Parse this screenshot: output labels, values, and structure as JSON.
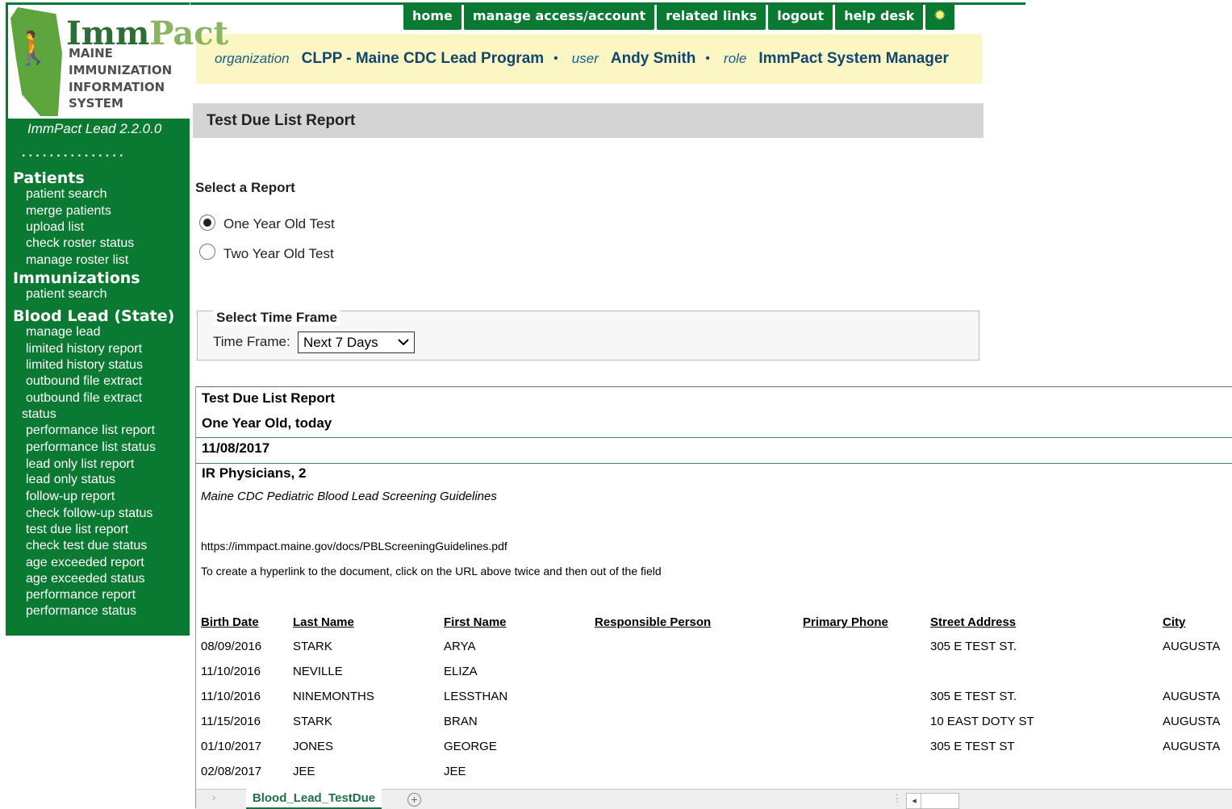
{
  "nav": {
    "home": "home",
    "manage": "manage access/account",
    "related": "related links",
    "logout": "logout",
    "help": "help desk",
    "bulb_icon": "lightbulb-icon"
  },
  "info": {
    "org_label": "organization",
    "org": "CLPP - Maine CDC Lead Program",
    "sep": "•",
    "user_label": "user",
    "user": "Andy Smith",
    "role_label": "role",
    "role": "ImmPact System Manager"
  },
  "logo": {
    "imm": "Imm",
    "pact": "Pact",
    "line1": "MAINE",
    "line2": "IMMUNIZATION",
    "line3": "INFORMATION",
    "line4": "SYSTEM"
  },
  "sidebar": {
    "version": "ImmPact Lead 2.2.0.0",
    "dots": "...............",
    "sections": {
      "patients": "Patients",
      "immunizations": "Immunizations",
      "lead": "Blood Lead (State)"
    },
    "patients_links": [
      "patient search",
      "merge patients",
      "upload list",
      "check roster status",
      "manage roster list"
    ],
    "imm_links": [
      "patient search"
    ],
    "lead_links": [
      "manage lead",
      "limited history report",
      "limited history status",
      "outbound file extract",
      "outbound file extract",
      "status",
      "performance list report",
      "performance list status",
      "lead only list report",
      "lead only status",
      "follow-up report",
      "check follow-up status",
      "test due list report",
      "check test due status",
      "age exceeded report",
      "age exceeded status",
      "performance report",
      "performance status"
    ]
  },
  "main": {
    "page_title": "Test Due List Report",
    "select_report": "Select a Report",
    "options": [
      "One Year Old Test",
      "Two Year Old Test"
    ],
    "selected_option": 0,
    "time_frame_legend": "Select Time Frame",
    "time_frame_label": "Time Frame:",
    "time_frame_value": "Next 7 Days"
  },
  "report": {
    "title": "Test Due List Report",
    "subtitle": "One Year Old, today",
    "date": "11/08/2017",
    "physician": "IR Physicians, 2",
    "guidelines": "Maine CDC Pediatric Blood Lead Screening Guidelines",
    "url": "https://immpact.maine.gov/docs/PBLScreeningGuidelines.pdf",
    "hint": "To create a hyperlink to the document, click on the URL above twice and then out of the field",
    "columns": [
      "Birth Date",
      "Last Name",
      "First Name",
      "Responsible Person",
      "Primary Phone",
      "Street Address",
      "City"
    ],
    "rows": [
      [
        "08/09/2016",
        "STARK",
        "ARYA",
        "",
        "",
        "305 E TEST ST.",
        "AUGUSTA"
      ],
      [
        "11/10/2016",
        "NEVILLE",
        "ELIZA",
        "",
        "",
        "",
        ""
      ],
      [
        "11/10/2016",
        "NINEMONTHS",
        "LESSTHAN",
        "",
        "",
        "305 E TEST ST.",
        "AUGUSTA"
      ],
      [
        "11/15/2016",
        "STARK",
        "BRAN",
        "",
        "",
        "10 EAST DOTY ST",
        "AUGUSTA"
      ],
      [
        "01/10/2017",
        "JONES",
        "GEORGE",
        "",
        "",
        "305 E TEST ST",
        "AUGUSTA"
      ],
      [
        "02/08/2017",
        "JEE",
        "JEE",
        "",
        "",
        "",
        ""
      ]
    ],
    "sheet_tab": "Blood_Lead_TestDue",
    "add_sheet_icon": "plus-circle-icon"
  },
  "colors": {
    "brand_green": "#0a7a33",
    "info_bg": "#fbf6c3",
    "info_text": "#13466e"
  }
}
